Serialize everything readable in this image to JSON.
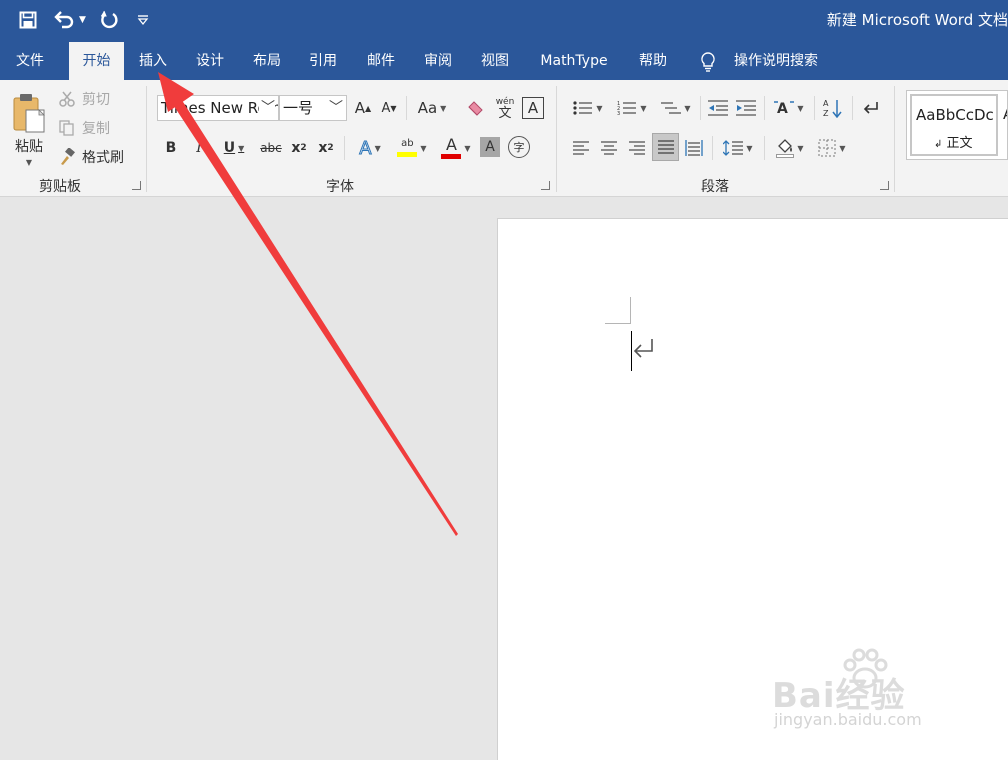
{
  "titlebar": {
    "doc_title": "新建 Microsoft Word 文档",
    "bg_color": "#2b579a"
  },
  "quick_access": {
    "save_icon": "save-icon",
    "undo_icon": "undo-icon",
    "redo_icon": "redo-icon",
    "customize_icon": "customize-dropdown-icon"
  },
  "tabs": [
    {
      "label": "文件",
      "active": false
    },
    {
      "label": "开始",
      "active": true
    },
    {
      "label": "插入",
      "active": false
    },
    {
      "label": "设计",
      "active": false
    },
    {
      "label": "布局",
      "active": false
    },
    {
      "label": "引用",
      "active": false
    },
    {
      "label": "邮件",
      "active": false
    },
    {
      "label": "审阅",
      "active": false
    },
    {
      "label": "视图",
      "active": false
    },
    {
      "label": "MathType",
      "active": false
    },
    {
      "label": "帮助",
      "active": false
    }
  ],
  "tell_me": {
    "label": "操作说明搜索",
    "icon": "lightbulb-icon"
  },
  "clipboard": {
    "group_label": "剪贴板",
    "paste_label": "粘贴",
    "cut_label": "剪切",
    "copy_label": "复制",
    "format_painter_label": "格式刷"
  },
  "font": {
    "group_label": "字体",
    "font_name": "Times New Roman",
    "font_size": "一号",
    "grow_font": "A",
    "shrink_font": "A",
    "change_case": "Aa",
    "bold": "B",
    "italic": "I",
    "underline": "U",
    "strikethrough": "abc",
    "subscript": "x",
    "subscript_mark": "2",
    "superscript": "x",
    "superscript_mark": "2",
    "text_effects": "A",
    "highlight_text": "ab",
    "font_color_text": "A",
    "char_shading": "A",
    "phonetic_top": "wén",
    "phonetic_bottom": "文",
    "char_border": "A",
    "enclose_char": "字",
    "highlight_color": "#ffff00",
    "font_color": "#e00000"
  },
  "paragraph": {
    "group_label": "段落"
  },
  "styles": {
    "normal_preview": "AaBbCcDc",
    "normal_label": "正文"
  },
  "document": {
    "paragraph_mark": "↵"
  },
  "annotation": {
    "arrow_color": "#f03c3c"
  },
  "watermark": {
    "brand": "Bai经验",
    "url": "jingyan.baidu.com"
  }
}
